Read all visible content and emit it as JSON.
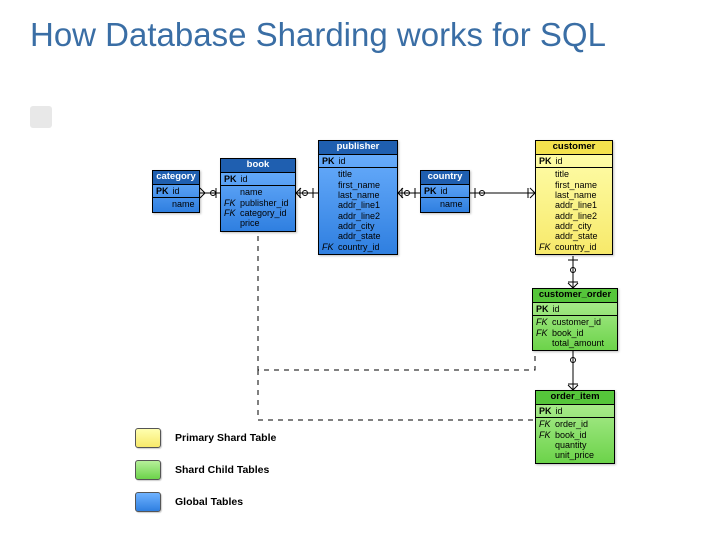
{
  "title": "How Database Sharding works for SQL",
  "entities": {
    "category": {
      "name": "category",
      "pk": "id",
      "cols": [
        {
          "fk": false,
          "name": "name"
        }
      ]
    },
    "book": {
      "name": "book",
      "pk": "id",
      "cols": [
        {
          "fk": false,
          "name": "name"
        },
        {
          "fk": true,
          "name": "publisher_id"
        },
        {
          "fk": true,
          "name": "category_id"
        },
        {
          "fk": false,
          "name": "price"
        }
      ]
    },
    "publisher": {
      "name": "publisher",
      "pk": "id",
      "cols": [
        {
          "fk": false,
          "name": "title"
        },
        {
          "fk": false,
          "name": "first_name"
        },
        {
          "fk": false,
          "name": "last_name"
        },
        {
          "fk": false,
          "name": "addr_line1"
        },
        {
          "fk": false,
          "name": "addr_line2"
        },
        {
          "fk": false,
          "name": "addr_city"
        },
        {
          "fk": false,
          "name": "addr_state"
        },
        {
          "fk": true,
          "name": "country_id"
        }
      ]
    },
    "country": {
      "name": "country",
      "pk": "id",
      "cols": [
        {
          "fk": false,
          "name": "name"
        }
      ]
    },
    "customer": {
      "name": "customer",
      "pk": "id",
      "cols": [
        {
          "fk": false,
          "name": "title"
        },
        {
          "fk": false,
          "name": "first_name"
        },
        {
          "fk": false,
          "name": "last_name"
        },
        {
          "fk": false,
          "name": "addr_line1"
        },
        {
          "fk": false,
          "name": "addr_line2"
        },
        {
          "fk": false,
          "name": "addr_city"
        },
        {
          "fk": false,
          "name": "addr_state"
        },
        {
          "fk": true,
          "name": "country_id"
        }
      ]
    },
    "customer_order": {
      "name": "customer_order",
      "pk": "id",
      "cols": [
        {
          "fk": true,
          "name": "customer_id"
        },
        {
          "fk": true,
          "name": "book_id"
        },
        {
          "fk": false,
          "name": "total_amount"
        }
      ]
    },
    "order_item": {
      "name": "order_item",
      "pk": "id",
      "cols": [
        {
          "fk": true,
          "name": "order_id"
        },
        {
          "fk": true,
          "name": "book_id"
        },
        {
          "fk": false,
          "name": "quantity"
        },
        {
          "fk": false,
          "name": "unit_price"
        }
      ]
    }
  },
  "legend": {
    "primary": "Primary Shard Table",
    "child": "Shard Child Tables",
    "global": "Global Tables"
  },
  "pk_label": "PK",
  "fk_label": "FK"
}
